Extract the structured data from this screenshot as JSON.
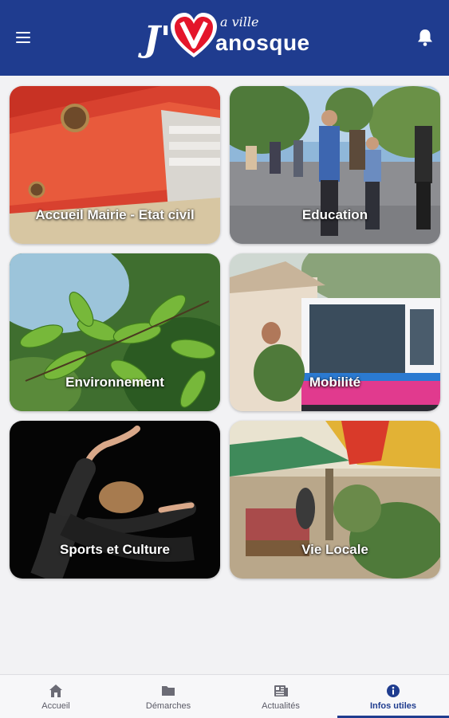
{
  "header": {
    "logo_j": "J'",
    "logo_small": "a ville",
    "logo_word": "anosque",
    "brand_color": "#1f3c8f",
    "accent_color": "#e4152a"
  },
  "tiles": [
    {
      "label": "Accueil Mairie - Etat civil",
      "icon": "binders-photo"
    },
    {
      "label": "Education",
      "icon": "family-street-photo"
    },
    {
      "label": "Environnement",
      "icon": "leaves-photo"
    },
    {
      "label": "Mobilité",
      "icon": "bus-photo"
    },
    {
      "label": "Sports et Culture",
      "icon": "dancer-photo"
    },
    {
      "label": "Vie Locale",
      "icon": "market-photo"
    }
  ],
  "tabbar": {
    "items": [
      {
        "label": "Accueil",
        "icon": "home-icon"
      },
      {
        "label": "Démarches",
        "icon": "folder-icon"
      },
      {
        "label": "Actualités",
        "icon": "news-icon"
      },
      {
        "label": "Infos utiles",
        "icon": "info-icon"
      }
    ],
    "active": "Infos utiles"
  }
}
